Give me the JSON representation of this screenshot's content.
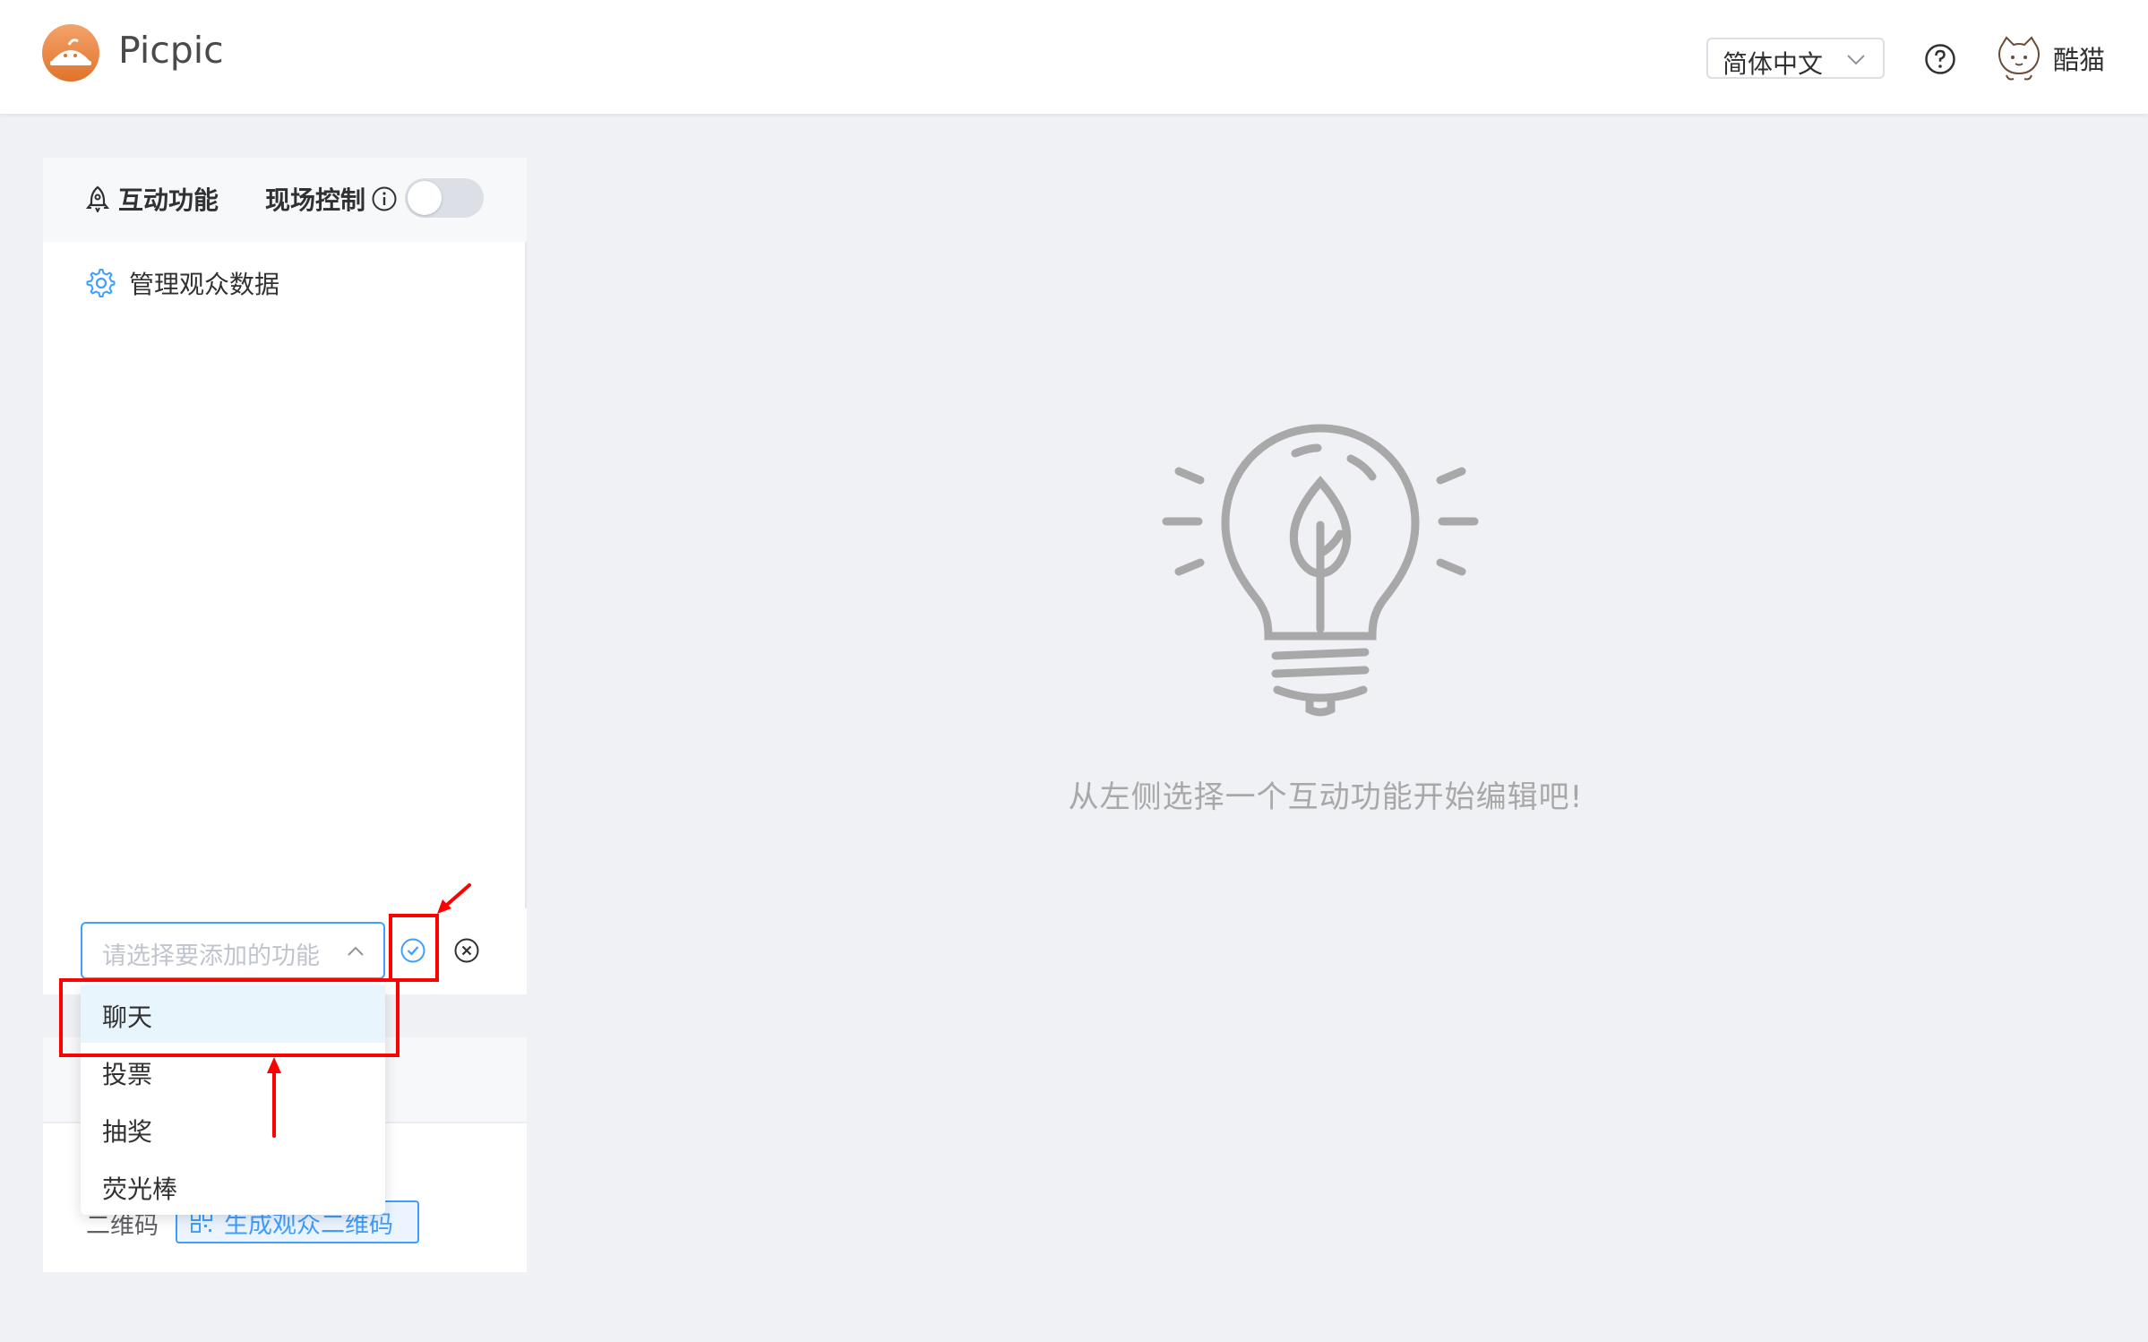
{
  "header": {
    "brand": "Picpic",
    "language": "简体中文",
    "user_name": "酷猫"
  },
  "sidebar": {
    "tab_label": "互动功能",
    "live_control_label": "现场控制",
    "live_control_on": false,
    "items": [
      {
        "label": "管理观众数据",
        "icon": "gear-icon"
      }
    ]
  },
  "add_feature": {
    "placeholder": "请选择要添加的功能",
    "options": [
      "聊天",
      "投票",
      "抽奖",
      "荧光棒"
    ],
    "highlighted_option": "聊天"
  },
  "qr": {
    "label": "二维码",
    "button_label": "生成观众二维码"
  },
  "empty_state": {
    "icon": "lightbulb-icon",
    "message": "从左侧选择一个互动功能开始编辑吧!"
  },
  "colors": {
    "accent": "#409eff",
    "annotation": "#ff0000",
    "brand_logo": "#e8833a"
  }
}
